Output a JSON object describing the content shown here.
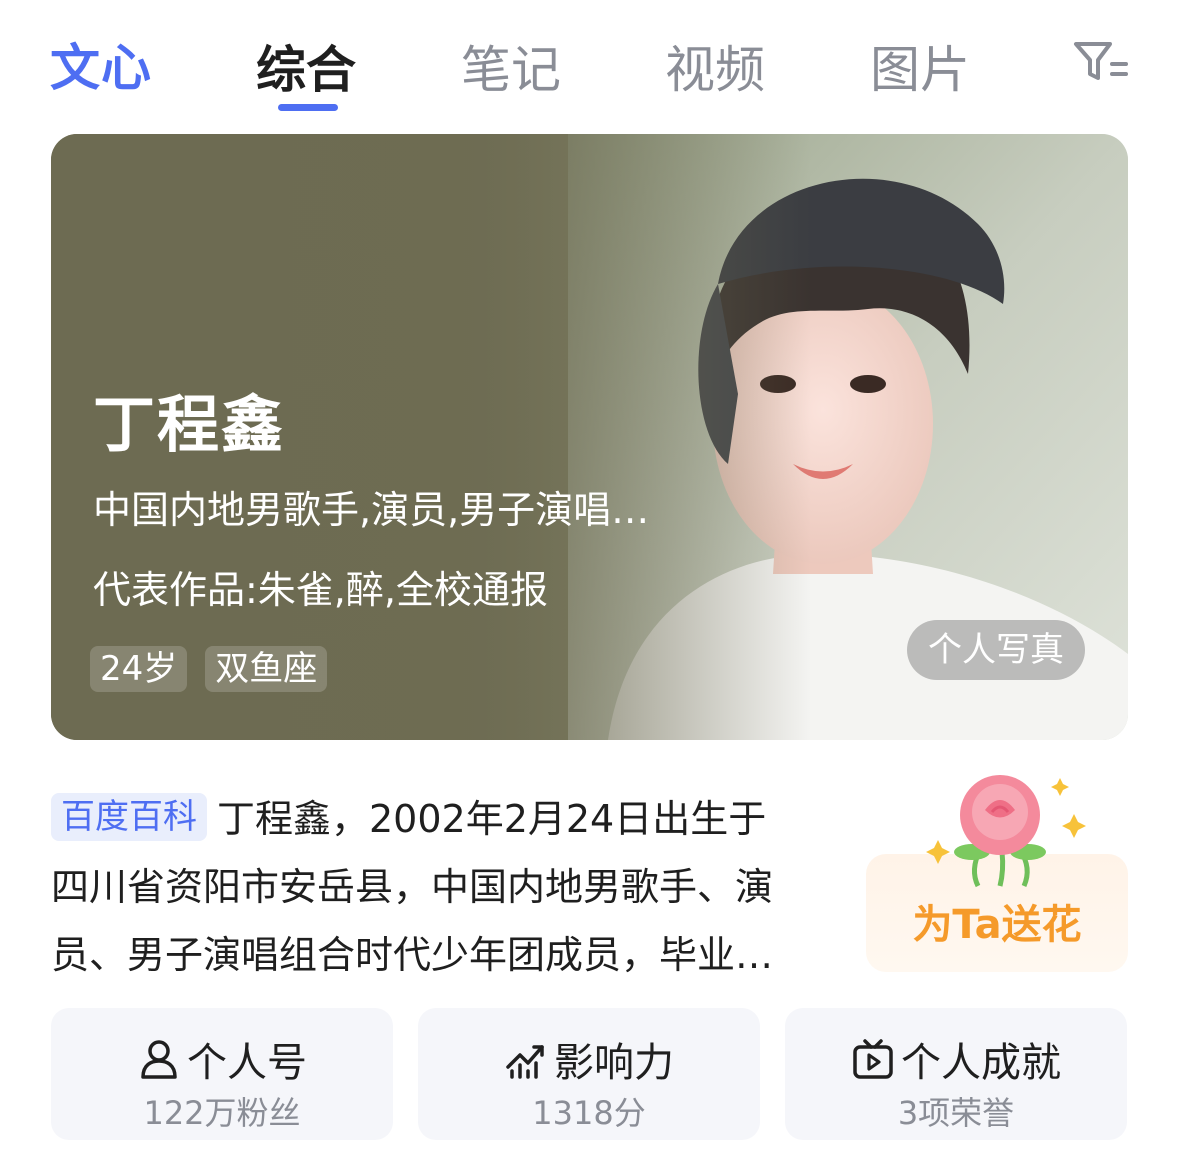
{
  "tabs": {
    "logo": "文心",
    "items": [
      "综合",
      "笔记",
      "视频",
      "图片"
    ],
    "active_index": 0
  },
  "hero": {
    "name": "丁程鑫",
    "description": "中国内地男歌手,演员,男子演唱…",
    "works": "代表作品:朱雀,醉,全校通报",
    "tags": [
      "24岁",
      "双鱼座"
    ],
    "photo_button": "个人写真"
  },
  "baike": {
    "tag": "百度百科",
    "line1": "丁程鑫，2002年2月24日出生于",
    "line2": "四川省资阳市安岳县，中国内地男歌手、演",
    "line3": "员、男子演唱组合时代少年团成员，毕业…"
  },
  "flower": {
    "label": "为Ta送花"
  },
  "stats": [
    {
      "title": "个人号",
      "sub": "122万粉丝",
      "icon": "person-icon"
    },
    {
      "title": "影响力",
      "sub": "1318分",
      "icon": "trend-chart-icon"
    },
    {
      "title": "个人成就",
      "sub": "3项荣誉",
      "icon": "tv-play-icon"
    }
  ],
  "colors": {
    "accent": "#4e6ef2",
    "flower_orange": "#f59a2a",
    "muted_text": "#8a8d96"
  }
}
